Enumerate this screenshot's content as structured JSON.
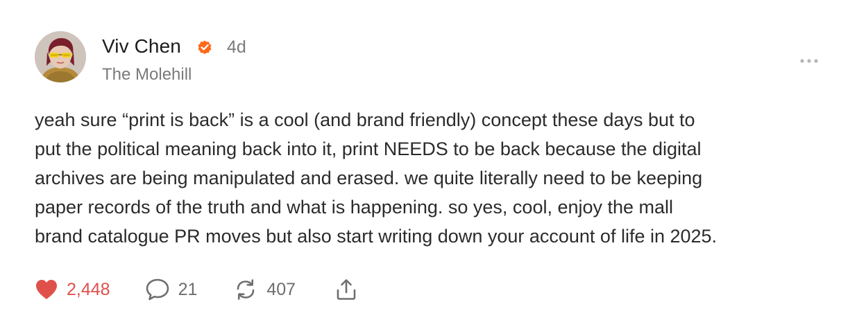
{
  "post": {
    "author": {
      "name": "Viv Chen",
      "verified_icon": "verified-badge-icon",
      "avatar": "avatar-photo"
    },
    "timestamp": "4d",
    "publication": "The Molehill",
    "body": "yeah sure “print is back” is a cool (and brand friendly) concept these days but to\nput the political meaning back into it, print NEEDS to be back because the digital\narchives are being manipulated and erased. we quite literally need to be keeping\npaper records of the truth and what is happening. so yes, cool, enjoy the mall\nbrand catalogue PR moves but also start writing down your account of life in 2025.",
    "actions": {
      "likes": "2,448",
      "comments": "21",
      "restacks": "407"
    }
  },
  "colors": {
    "like": "#e0504b",
    "verified": "#ff6719",
    "muted": "#7a7a7a",
    "text": "#2b2b2b"
  },
  "icons": {
    "like": "heart-icon",
    "comment": "comment-bubble-icon",
    "restack": "restack-icon",
    "share": "share-icon",
    "more": "more-dots-icon"
  }
}
